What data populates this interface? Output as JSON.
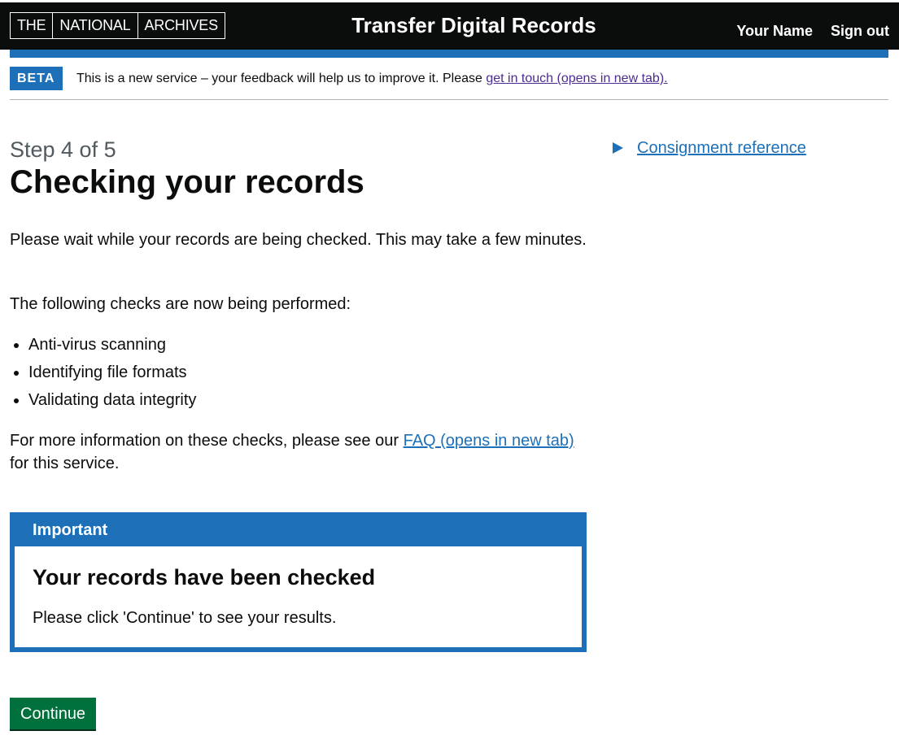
{
  "header": {
    "logo": [
      "THE",
      "NATIONAL",
      "ARCHIVES"
    ],
    "service_name": "Transfer Digital Records",
    "nav": {
      "user_name": "Your Name",
      "sign_out": "Sign out"
    }
  },
  "phase_banner": {
    "tag": "BETA",
    "text": "This is a new service – your feedback will help us to improve it. Please ",
    "link": "get in touch (opens in new tab)."
  },
  "main": {
    "caption": "Step 4 of 5",
    "title": "Checking your records",
    "intro": "Please wait while your records are being checked. This may take a few minutes.",
    "checks_intro": "The following checks are now being performed:",
    "checks": [
      "Anti-virus scanning",
      "Identifying file formats",
      "Validating data integrity"
    ],
    "faq_prefix": "For more information on these checks, please see our ",
    "faq_link": "FAQ (opens in new tab)",
    "faq_suffix": " for this service."
  },
  "notification": {
    "title": "Important",
    "heading": "Your records have been checked",
    "body": "Please click 'Continue' to see your results."
  },
  "continue_button": "Continue",
  "side": {
    "details_summary": "Consignment reference"
  },
  "colors": {
    "header_bg": "#0b0c0c",
    "accent_blue": "#1d70b8",
    "button_green": "#00703c",
    "visited_link": "#4c2c92"
  }
}
